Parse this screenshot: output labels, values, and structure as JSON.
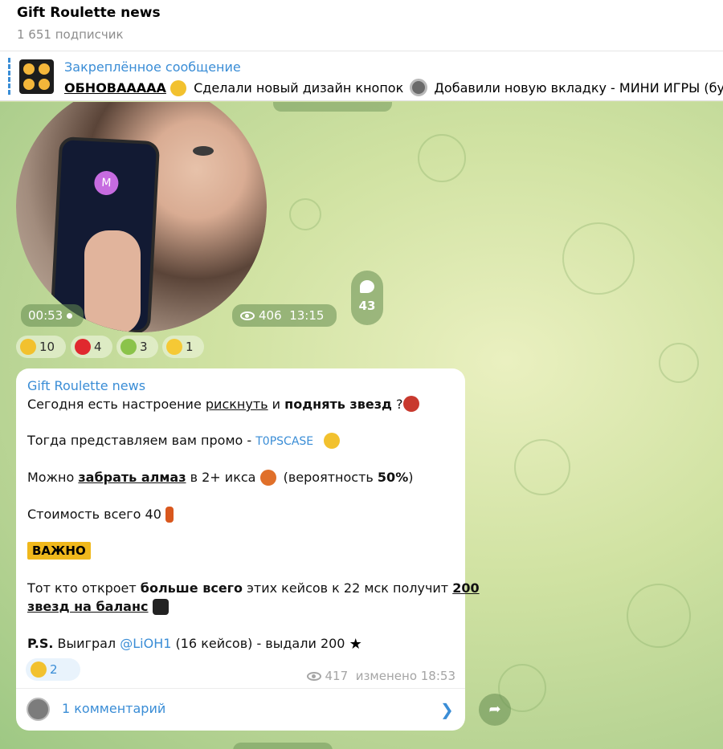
{
  "channel": {
    "title": "Gift Roulette news",
    "subscribers": "1 651 подписчик"
  },
  "pinned": {
    "label": "Закреплённое сообщение",
    "bold": "ОБНОВААААА",
    "text_a": " Сделали новый дизайн кнопок ",
    "text_b": " Добавили новую вкладку - МИНИ ИГРЫ (будут"
  },
  "video_message": {
    "duration": "00:53",
    "views": "406",
    "time": "13:15",
    "comments": "43",
    "reactions": [
      {
        "emoji": "cool-duck",
        "count": "10",
        "color": "#f2c12e"
      },
      {
        "emoji": "red-heart",
        "count": "4",
        "color": "#e0282e"
      },
      {
        "emoji": "party-duck",
        "count": "3",
        "color": "#8bc34a"
      },
      {
        "emoji": "yellow-duck",
        "count": "1",
        "color": "#f5c935"
      }
    ]
  },
  "post": {
    "author": "Gift Roulette news",
    "l1_a": "Сегодня есть настроение ",
    "l1_b": "рискнуть",
    "l1_c": " и ",
    "l1_d": "поднять звезд",
    "l1_e": " ?",
    "l2_a": "Тогда представляем вам промо - ",
    "l2_code": "T0PSCASE",
    "l3_a": "Можно ",
    "l3_b": "забрать алмаз",
    "l3_c": " в 2+ икса ",
    "l3_d": " (вероятность ",
    "l3_e": "50%",
    "l3_f": ")",
    "l4": "Стоимость всего 40 ",
    "badge": "ВАЖНО",
    "l5_a": "Тот кто откроет ",
    "l5_b": "больше всего",
    "l5_c": " этих кейсов к 22 мск получит ",
    "l5_d": "200",
    "l6": "звезд на баланс",
    "l7_a": "P.S.",
    "l7_b": " Выиграл ",
    "l7_link": "@LiOH1",
    "l7_c": " (16 кейсов) - выдали 200 ",
    "reaction_count": "2",
    "views": "417",
    "edited": "изменено 18:53",
    "comments_label": "1 комментарий"
  },
  "colors": {
    "accent": "#3a8dd6",
    "bubble": "#ffffff",
    "badge": "#f0b81c"
  }
}
